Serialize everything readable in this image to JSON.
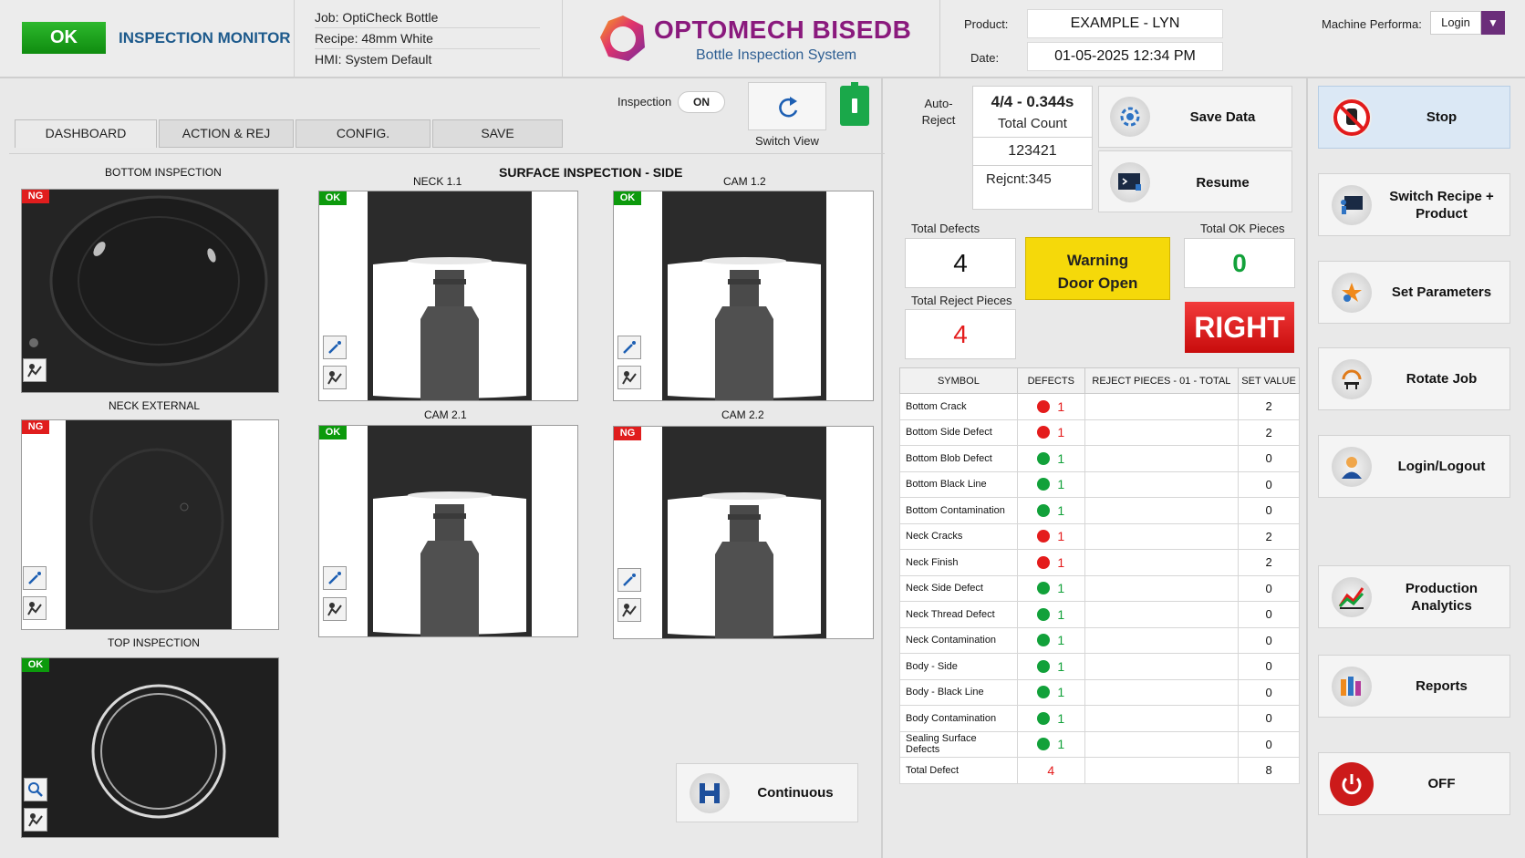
{
  "header": {
    "status_badge": "OK",
    "app_title": "INSPECTION MONITOR",
    "job": "Job: OptiCheck Bottle",
    "recipe": "Recipe: 48mm White",
    "hmi": "HMI: System Default",
    "brand_name": "OPTOMECH BISEDB",
    "brand_sub": "Bottle Inspection System",
    "product_label": "Product:",
    "product_value": "EXAMPLE - LYN",
    "date_label": "Date:",
    "date_value": "01-05-2025 12:34 PM",
    "machine_label": "Machine Performa:",
    "login_value": "Login"
  },
  "toolbar": {
    "inspection_label": "Inspection",
    "inspection_toggle": "ON",
    "switch_view": "Switch View"
  },
  "tabs": [
    "DASHBOARD",
    "ACTION & REJ",
    "CONFIG.",
    "SAVE"
  ],
  "cameras": {
    "bottom": {
      "title": "BOTTOM INSPECTION",
      "status": "NG"
    },
    "neck_ext": {
      "title": "NECK EXTERNAL",
      "status": "NG"
    },
    "top": {
      "title": "TOP INSPECTION",
      "status": "OK"
    },
    "surface_title": "SURFACE INSPECTION - SIDE",
    "neck11": {
      "title": "NECK 1.1",
      "status": "OK"
    },
    "cam12": {
      "title": "CAM 1.2",
      "status": "OK"
    },
    "cam21": {
      "title": "CAM 2.1",
      "status": "OK"
    },
    "cam22": {
      "title": "CAM 2.2",
      "status": "NG"
    }
  },
  "mode_button": "Continuous",
  "counters": {
    "auto_reject": "Auto-\nReject",
    "ratio": "4/4 - 0.344s",
    "total_count_label": "Total Count",
    "total_count": "123421",
    "rejcnt": "Rejcnt:345",
    "save_data": "Save Data",
    "resume": "Resume",
    "total_defects_label": "Total Defects",
    "total_defects": "4",
    "warning_line1": "Warning",
    "warning_line2": "Door Open",
    "total_ok_label": "Total OK Pieces",
    "total_ok": "0",
    "total_reject_label": "Total Reject Pieces",
    "total_reject": "4",
    "direction": "RIGHT"
  },
  "table": {
    "headers": [
      "SYMBOL",
      "DEFECTS",
      "REJECT PIECES - 01 - TOTAL",
      "SET VALUE"
    ],
    "rows": [
      {
        "symbol": "Bottom Crack",
        "status": "red",
        "defects": "1",
        "reject": "",
        "set": "2"
      },
      {
        "symbol": "Bottom Side Defect",
        "status": "red",
        "defects": "1",
        "reject": "",
        "set": "2"
      },
      {
        "symbol": "Bottom Blob Defect",
        "status": "green",
        "defects": "1",
        "reject": "",
        "set": "0"
      },
      {
        "symbol": "Bottom Black Line",
        "status": "green",
        "defects": "1",
        "reject": "",
        "set": "0"
      },
      {
        "symbol": "Bottom Contamination",
        "status": "green",
        "defects": "1",
        "reject": "",
        "set": "0"
      },
      {
        "symbol": "Neck Cracks",
        "status": "red",
        "defects": "1",
        "reject": "",
        "set": "2"
      },
      {
        "symbol": "Neck Finish",
        "status": "red",
        "defects": "1",
        "reject": "",
        "set": "2"
      },
      {
        "symbol": "Neck Side Defect",
        "status": "green",
        "defects": "1",
        "reject": "",
        "set": "0"
      },
      {
        "symbol": "Neck Thread Defect",
        "status": "green",
        "defects": "1",
        "reject": "",
        "set": "0"
      },
      {
        "symbol": "Neck Contamination",
        "status": "green",
        "defects": "1",
        "reject": "",
        "set": "0"
      },
      {
        "symbol": "Body - Side",
        "status": "green",
        "defects": "1",
        "reject": "",
        "set": "0"
      },
      {
        "symbol": "Body - Black Line",
        "status": "green",
        "defects": "1",
        "reject": "",
        "set": "0"
      },
      {
        "symbol": "Body Contamination",
        "status": "green",
        "defects": "1",
        "reject": "",
        "set": "0"
      },
      {
        "symbol": "Sealing Surface Defects",
        "status": "green",
        "defects": "1",
        "reject": "",
        "set": "0"
      }
    ],
    "total_label": "Total Defect",
    "total_defects": "4",
    "total_set": "8"
  },
  "side_buttons": {
    "stop": "Stop",
    "switch_recipe": "Switch Recipe +\nProduct",
    "set_parameters": "Set Parameters",
    "rotate_job": "Rotate Job",
    "login_logout": "Login/Logout",
    "production_analytics": "Production\nAnalytics",
    "reports": "Reports",
    "off": "OFF"
  }
}
